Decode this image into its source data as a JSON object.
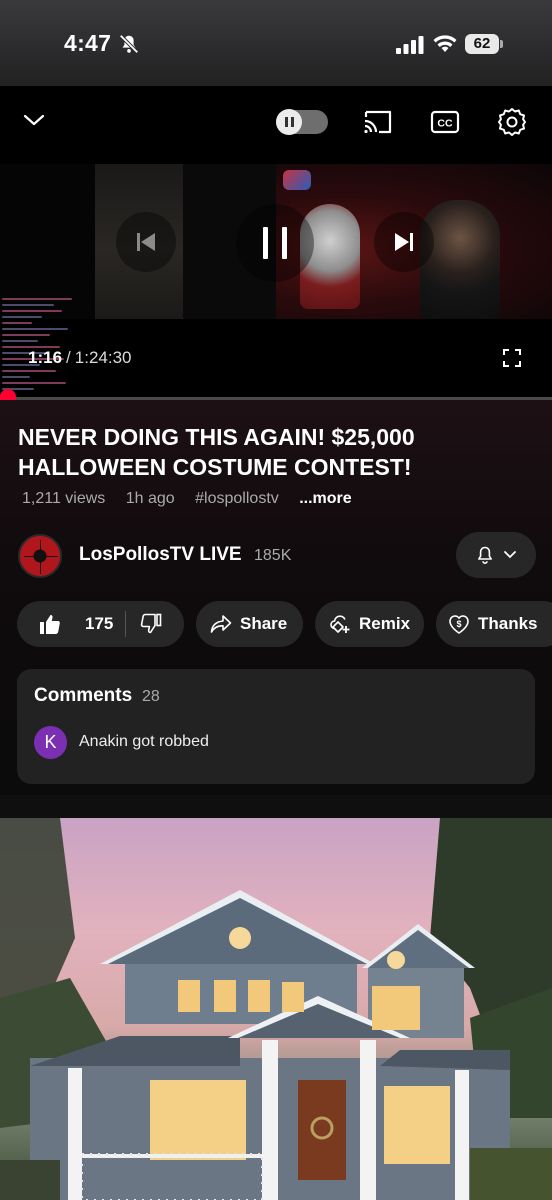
{
  "status_bar": {
    "time": "4:47",
    "battery": "62"
  },
  "player": {
    "current_time": "1:16",
    "duration": "1:24:30",
    "time_separator": "/",
    "progress_fraction": 0.015,
    "accent_color": "#ff0033"
  },
  "video": {
    "title": "NEVER DOING THIS AGAIN! $25,000 HALLOWEEN COSTUME CONTEST!",
    "views": "1,211 views",
    "age": "1h ago",
    "hashtag": "#lospollostv",
    "more_label": "...more"
  },
  "channel": {
    "name": "LosPollosTV LIVE",
    "subscribers": "185K"
  },
  "actions": {
    "like_count": "175",
    "share_label": "Share",
    "remix_label": "Remix",
    "thanks_label": "Thanks"
  },
  "comments": {
    "title": "Comments",
    "count": "28",
    "top_comment": {
      "avatar_letter": "K",
      "text": "Anakin got robbed"
    }
  },
  "icons": {
    "collapse": "chevron-down-icon",
    "autoplay": "autoplay-toggle",
    "cast": "cast-icon",
    "captions": "cc-icon",
    "settings": "gear-icon",
    "previous": "skip-previous-icon",
    "pause": "pause-icon",
    "next": "skip-next-icon",
    "fullscreen": "fullscreen-icon",
    "notifications": "bell-icon",
    "like": "thumbs-up-icon",
    "dislike": "thumbs-down-icon",
    "share": "share-arrow-icon",
    "remix": "remix-icon",
    "thanks": "thanks-heart-icon"
  }
}
